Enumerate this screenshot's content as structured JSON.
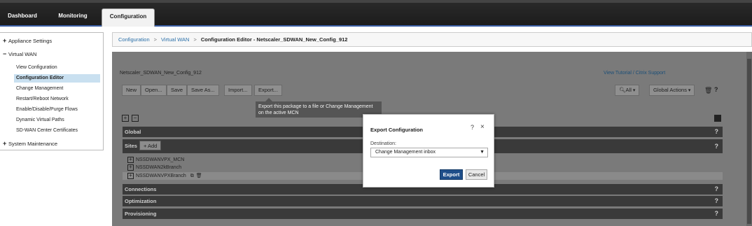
{
  "nav": {
    "tabs": [
      {
        "label": "Dashboard"
      },
      {
        "label": "Monitoring"
      },
      {
        "label": "Configuration"
      }
    ]
  },
  "sidebar": {
    "appliance_settings": "Appliance Settings",
    "virtual_wan": "Virtual WAN",
    "items": [
      {
        "label": "View Configuration"
      },
      {
        "label": "Configuration Editor"
      },
      {
        "label": "Change Management"
      },
      {
        "label": "Restart/Reboot Network"
      },
      {
        "label": "Enable/Disable/Purge Flows"
      },
      {
        "label": "Dynamic Virtual Paths"
      },
      {
        "label": "SD-WAN Center Certificates"
      }
    ],
    "system_maintenance": "System Maintenance"
  },
  "breadcrumb": {
    "configuration": "Configuration",
    "virtual_wan": "Virtual WAN",
    "current": "Configuration Editor - Netscaler_SDWAN_New_Config_912",
    "separator": ">"
  },
  "editor": {
    "package_name": "Netscaler_SDWAN_New_Config_912",
    "tutorial_link": "View Tutorial / Citrix Support",
    "toolbar": {
      "new": "New",
      "open": "Open...",
      "save": "Save",
      "save_as": "Save As...",
      "import": "Import...",
      "export": "Export...",
      "filter_all": "All",
      "global_actions": "Global Actions"
    },
    "tooltip": "Export this package to a file or Change Management on the active MCN",
    "sections": {
      "global": "Global",
      "sites": "Sites",
      "add": "Add",
      "connections": "Connections",
      "optimization": "Optimization",
      "provisioning": "Provisioning"
    },
    "sites": [
      {
        "name": "NSSDWANVPX_MCN"
      },
      {
        "name": "NSSDWAN2kBranch"
      },
      {
        "name": "NSSDWANVPXBranch"
      }
    ]
  },
  "dialog": {
    "title": "Export Configuration",
    "destination_label": "Destination:",
    "destination_value": "Change Management inbox",
    "export_button": "Export",
    "cancel_button": "Cancel"
  }
}
